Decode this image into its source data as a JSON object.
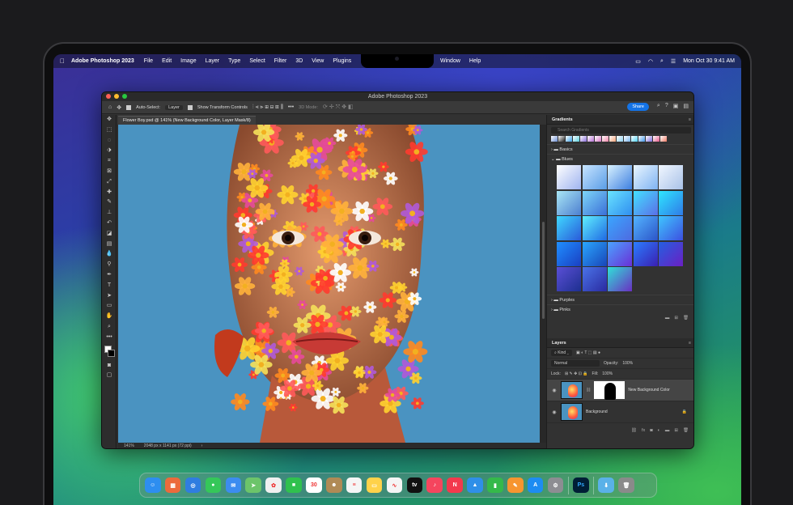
{
  "menubar": {
    "app_name": "Adobe Photoshop 2023",
    "menus": [
      "File",
      "Edit",
      "Image",
      "Layer",
      "Type",
      "Select",
      "Filter",
      "3D",
      "View",
      "Plugins"
    ],
    "menus_right": [
      "Window",
      "Help"
    ],
    "clock": "Mon Oct 30  9:41 AM",
    "icons": [
      "apple-icon",
      "cast-icon",
      "wifi-icon",
      "search-icon",
      "control-center-icon"
    ]
  },
  "window": {
    "title": "Adobe Photoshop 2023",
    "options": {
      "auto_select_label": "Auto-Select:",
      "auto_select_value": "Layer",
      "transform_label": "Show Transform Controls",
      "mode_3d": "3D Mode:",
      "share_label": "Share"
    },
    "doc_tab": "Flower Boy.psd @ 141% (New Background Color, Layer Mask/8)",
    "status": {
      "zoom": "141%",
      "dimensions": "2048 px x 1141 px (72 ppi)"
    }
  },
  "gradients_panel": {
    "tab": "Gradients",
    "search_placeholder": "Search Gradients",
    "folders": [
      "Basics",
      "Blues",
      "Purples",
      "Pinks"
    ],
    "top_swatches": [
      "#6c8fd6",
      "#222",
      "#3fa4e8",
      "#59d0e0",
      "#8a6ddb",
      "#b56fd6",
      "#d977c7",
      "#f083a8",
      "#f5a47a",
      "#8fd0f0",
      "#7ab6ee",
      "#4fd2f5",
      "#3f96e8",
      "#7f6fe0",
      "#e45a8a",
      "#f07a66"
    ],
    "blues_swatches": [
      [
        "#ffffff",
        "#9fb4f0"
      ],
      [
        "#c7e4ff",
        "#5a9de6"
      ],
      [
        "#d9f2ff",
        "#3d7fe0"
      ],
      [
        "#eaf6ff",
        "#7fb3f2"
      ],
      [
        "#f1f7ff",
        "#a9c2e8"
      ],
      [
        "#a9e6f5",
        "#4c7fd0"
      ],
      [
        "#7ed6f7",
        "#3a6fd8"
      ],
      [
        "#69e3ff",
        "#2f8ef0"
      ],
      [
        "#43e0ff",
        "#5a6fe8"
      ],
      [
        "#2fe6ff",
        "#2f7be8"
      ],
      [
        "#3fd8ff",
        "#2a5ad9"
      ],
      [
        "#5ff0ff",
        "#1f69e3"
      ],
      [
        "#3aa6ff",
        "#4e6ae0"
      ],
      [
        "#53b4ff",
        "#2c54c8"
      ],
      [
        "#3ec6ff",
        "#3d4fe0"
      ],
      [
        "#1f8fff",
        "#1a3fc2"
      ],
      [
        "#2aa7ff",
        "#1845b8"
      ],
      [
        "#4aa4ff",
        "#6a2fd6"
      ],
      [
        "#2b7dff",
        "#3a1fb2"
      ],
      [
        "#245fe0",
        "#6b1fc4"
      ],
      [
        "#5a4fd6",
        "#1d2f8f"
      ],
      [
        "#4a73e8",
        "#2a2aa0"
      ],
      [
        "#2fe0d8",
        "#6a2fc2"
      ]
    ]
  },
  "layers_panel": {
    "tab": "Layers",
    "kind_label": "Kind",
    "blend_mode": "Normal",
    "opacity_label": "Opacity:",
    "opacity_value": "100%",
    "lock_label": "Lock:",
    "fill_label": "Fill:",
    "fill_value": "100%",
    "layers": [
      {
        "name": "New Background Color",
        "selected": true
      },
      {
        "name": "Background",
        "selected": false
      }
    ]
  },
  "dock": {
    "apps": [
      {
        "name": "finder-icon",
        "color": "#2d8ef0",
        "glyph": "☺"
      },
      {
        "name": "launchpad-icon",
        "color": "#ec6a3c",
        "glyph": "▦"
      },
      {
        "name": "safari-icon",
        "color": "#2f7de0",
        "glyph": "◎"
      },
      {
        "name": "messages-icon",
        "color": "#35c759",
        "glyph": "●"
      },
      {
        "name": "mail-icon",
        "color": "#3c8cf0",
        "glyph": "✉"
      },
      {
        "name": "maps-icon",
        "color": "#6cc46a",
        "glyph": "➤"
      },
      {
        "name": "photos-icon",
        "color": "#f0f0f0",
        "glyph": "✿"
      },
      {
        "name": "facetime-icon",
        "color": "#30c14e",
        "glyph": "■"
      },
      {
        "name": "calendar-icon",
        "color": "#ffffff",
        "glyph": "30"
      },
      {
        "name": "contacts-icon",
        "color": "#b08a55",
        "glyph": "☻"
      },
      {
        "name": "reminders-icon",
        "color": "#f5f5f5",
        "glyph": "≡"
      },
      {
        "name": "notes-icon",
        "color": "#ffd24a",
        "glyph": "▭"
      },
      {
        "name": "freeform-icon",
        "color": "#f5f5f5",
        "glyph": "∿"
      },
      {
        "name": "tv-icon",
        "color": "#111111",
        "glyph": "tv"
      },
      {
        "name": "music-icon",
        "color": "#f5455e",
        "glyph": "♪"
      },
      {
        "name": "news-icon",
        "color": "#f3394d",
        "glyph": "N"
      },
      {
        "name": "keynote-icon",
        "color": "#2f8fe8",
        "glyph": "▲"
      },
      {
        "name": "numbers-icon",
        "color": "#35b94a",
        "glyph": "▮"
      },
      {
        "name": "pages-icon",
        "color": "#f79530",
        "glyph": "✎"
      },
      {
        "name": "app-store-icon",
        "color": "#1d8cf2",
        "glyph": "A"
      },
      {
        "name": "system-settings-icon",
        "color": "#8d8d92",
        "glyph": "⚙"
      },
      {
        "name": "photoshop-icon",
        "color": "#001e36",
        "glyph": "Ps"
      },
      {
        "name": "downloads-folder-icon",
        "color": "#5ab1e8",
        "glyph": "⬇"
      },
      {
        "name": "trash-icon",
        "color": "#8a8a8a",
        "glyph": "🗑"
      }
    ]
  }
}
